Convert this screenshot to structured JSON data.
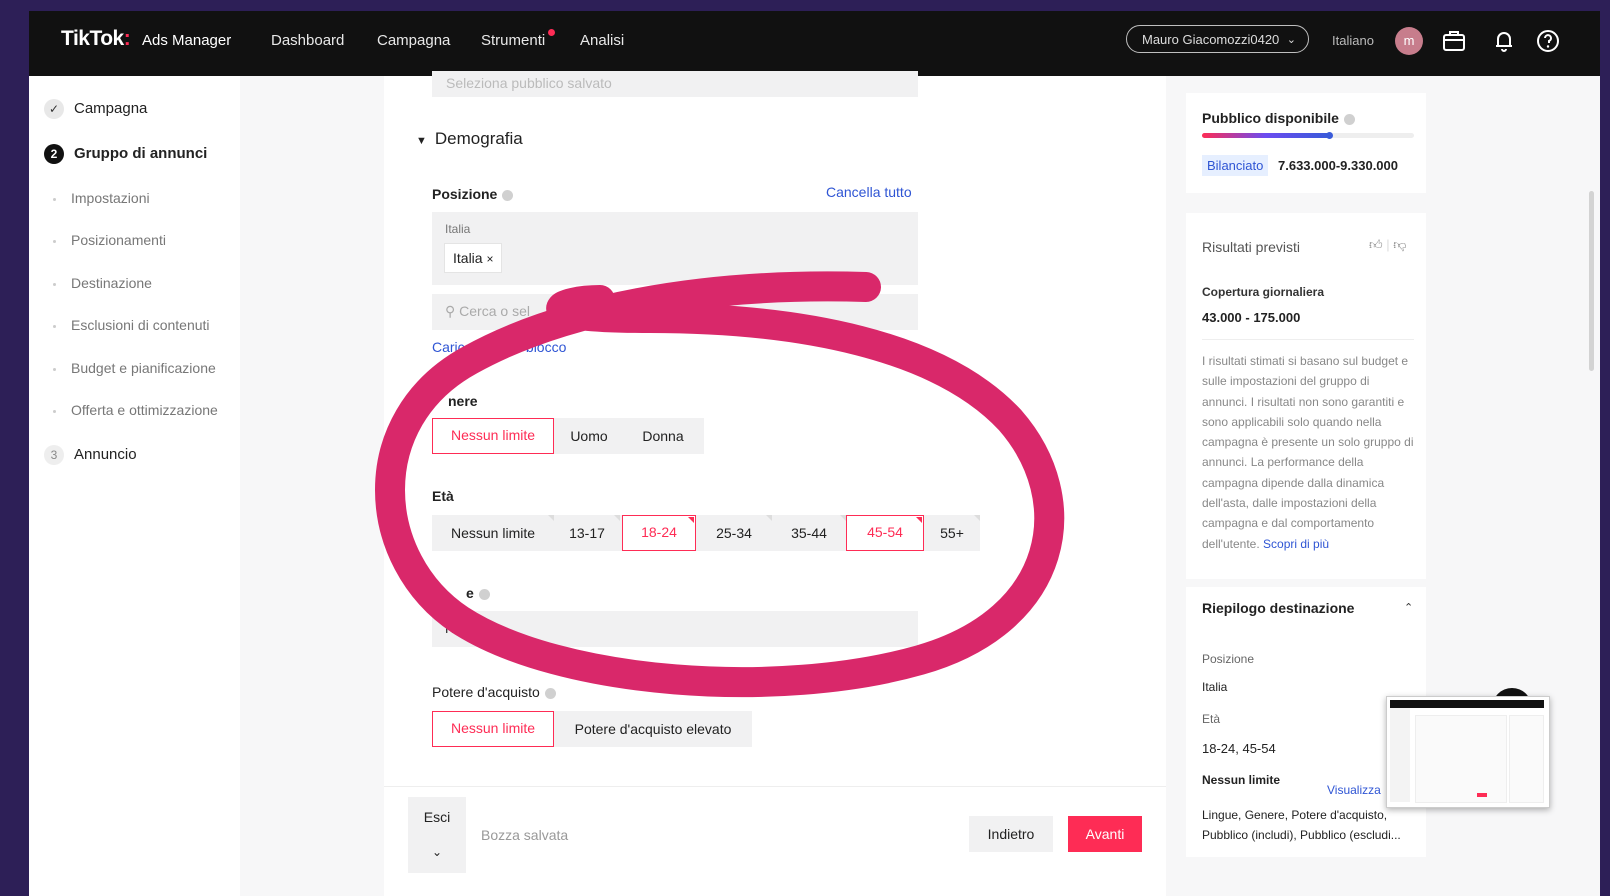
{
  "topbar": {
    "logo_main": "TikTok",
    "logo_colon": ":",
    "logo_sub": "Ads Manager",
    "nav": [
      "Dashboard",
      "Campagna",
      "Strumenti",
      "Analisi"
    ],
    "account": "Mauro Giacomozzi0420",
    "language": "Italiano",
    "avatar_letter": "m"
  },
  "sidebar": {
    "steps": [
      {
        "label": "Campagna",
        "state": "done",
        "icon": "check-icon"
      },
      {
        "label": "Gruppo di annunci",
        "state": "active",
        "number": "2"
      },
      {
        "label": "Annuncio",
        "state": "todo",
        "number": "3"
      }
    ],
    "substeps": [
      "Impostazioni",
      "Posizionamenti",
      "Destinazione",
      "Esclusioni di contenuti",
      "Budget e pianificazione",
      "Offerta e ottimizzazione"
    ]
  },
  "form": {
    "saved_audience_placeholder": "Seleziona pubblico salvato",
    "section": "Demografia",
    "location": {
      "label": "Posizione",
      "clear_all": "Cancella tutto",
      "group_label": "Italia",
      "chip": "Italia",
      "search_placeholder": "Cerca o sel",
      "bulk_upload_left": "Caricame",
      "bulk_upload_right": "blocco"
    },
    "gender": {
      "label": "nere",
      "options": [
        "Nessun limite",
        "Uomo",
        "Donna"
      ],
      "selected": [
        "Nessun limite"
      ]
    },
    "age": {
      "label": "Età",
      "options": [
        "Nessun limite",
        "13-17",
        "18-24",
        "25-34",
        "35-44",
        "45-54",
        "55+"
      ],
      "selected": [
        "18-24",
        "45-54"
      ]
    },
    "languages": {
      "label_fragment": "e",
      "value_fragment": "Nessun"
    },
    "purchasing_power": {
      "label": "Potere d'acquisto",
      "options": [
        "Nessun limite",
        "Potere d'acquisto elevato"
      ],
      "selected": [
        "Nessun limite"
      ]
    }
  },
  "bottom": {
    "exit": "Esci",
    "draft_status": "Bozza salvata",
    "back": "Indietro",
    "next": "Avanti"
  },
  "right_panel": {
    "audience": {
      "title": "Pubblico disponibile",
      "tag": "Bilanciato",
      "range": "7.633.000-9.330.000",
      "meter_level": 0.6
    },
    "estimates": {
      "title": "Risultati previsti",
      "reach_label": "Copertura giornaliera",
      "reach_value": "43.000 - 175.000",
      "disclaimer": "I risultati stimati si basano sul budget e sulle impostazioni del gruppo di annunci. I risultati non sono garantiti e sono applicabili solo quando nella campagna è presente un solo gruppo di annunci. La performance della campagna dipende dalla dinamica dell'asta, dalle impostazioni della campagna e dal comportamento dell'utente.",
      "learn_more": "Scopri di più"
    },
    "summary": {
      "title": "Riepilogo destinazione",
      "position_label": "Posizione",
      "position_value": "Italia",
      "age_label": "Età",
      "age_value": "18-24, 45-54",
      "no_limit_label": "Nessun limite",
      "view_link": "Visualizza",
      "no_limit_value": "Lingue, Genere, Potere d'acquisto, Pubblico (includi), Pubblico (escludi..."
    }
  },
  "colors": {
    "accent": "#fe2c55",
    "link": "#2f55d4",
    "annotation": "#d9286a",
    "background": "#2d1f57"
  }
}
